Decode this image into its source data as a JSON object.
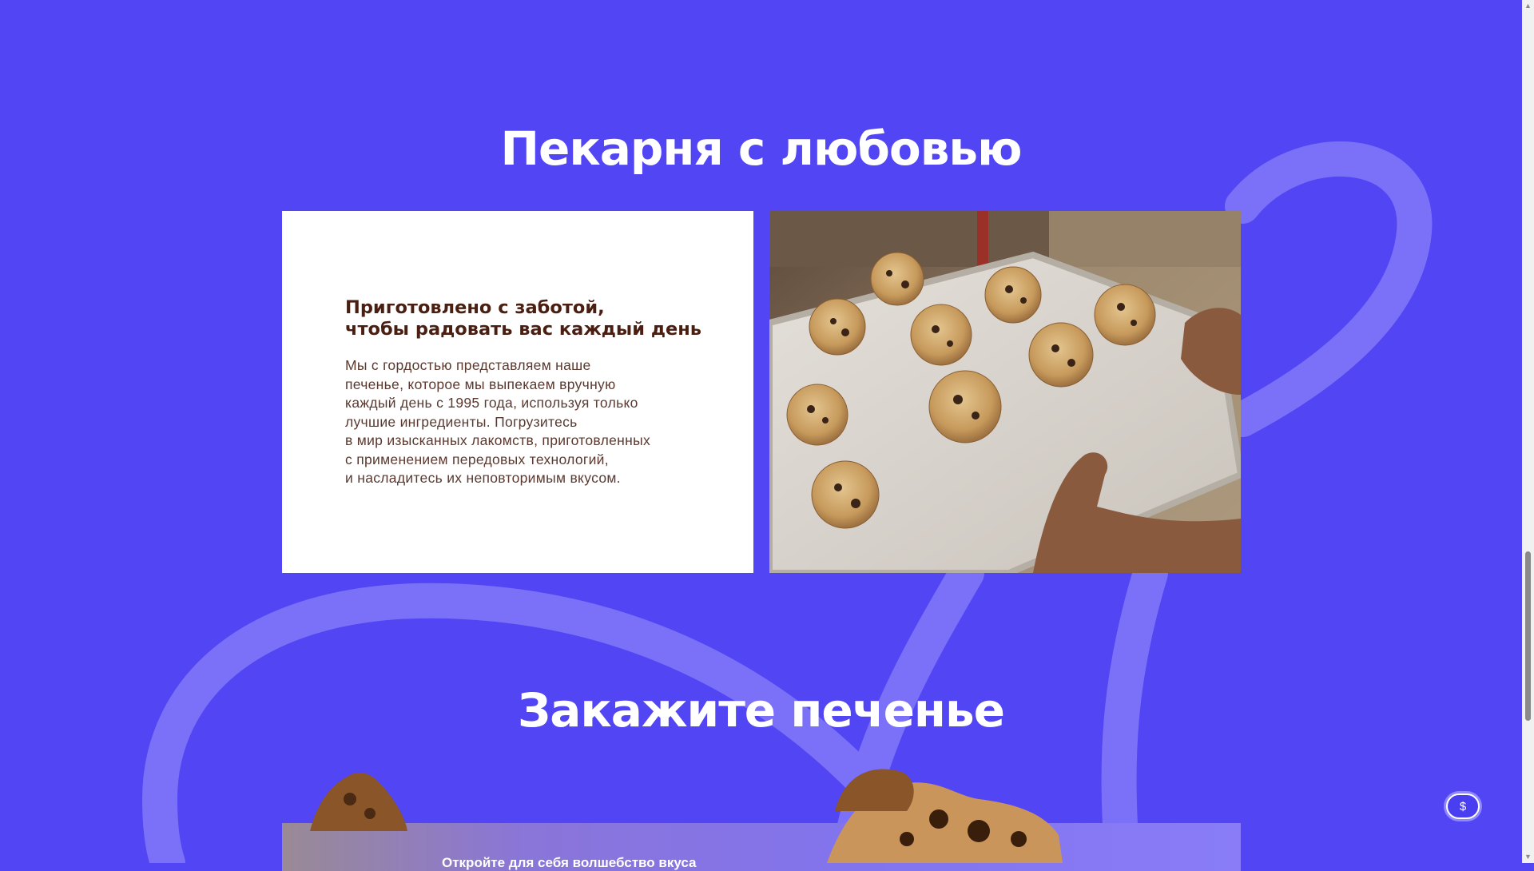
{
  "about": {
    "title": "Пекарня с любовью",
    "card_heading": [
      "Приготовлено с заботой,",
      "чтобы радовать вас каждый день"
    ],
    "card_body": [
      "Мы с гордостью представляем наше",
      "печенье, которое мы выпекаем вручную",
      "каждый день с 1995 года, используя только",
      "лучшие ингредиенты. Погрузитесь",
      "в мир изысканных лакомств, приготовленных",
      "с применением передовых технологий,",
      "и насладитесь их неповторимым вкусом."
    ],
    "photo_icon": "cookies-on-baking-tray-photo"
  },
  "order": {
    "title": "Закажите печенье",
    "promo_text": "Откройте для себя волшебство вкуса"
  },
  "currency_button": {
    "label": "$",
    "icon": "dollar-icon"
  },
  "colors": {
    "background": "#5145f4",
    "ribbon": "#7b70f8",
    "card_heading": "#4a1f12",
    "card_body": "#5a3a30",
    "card_background": "#ffffff"
  }
}
